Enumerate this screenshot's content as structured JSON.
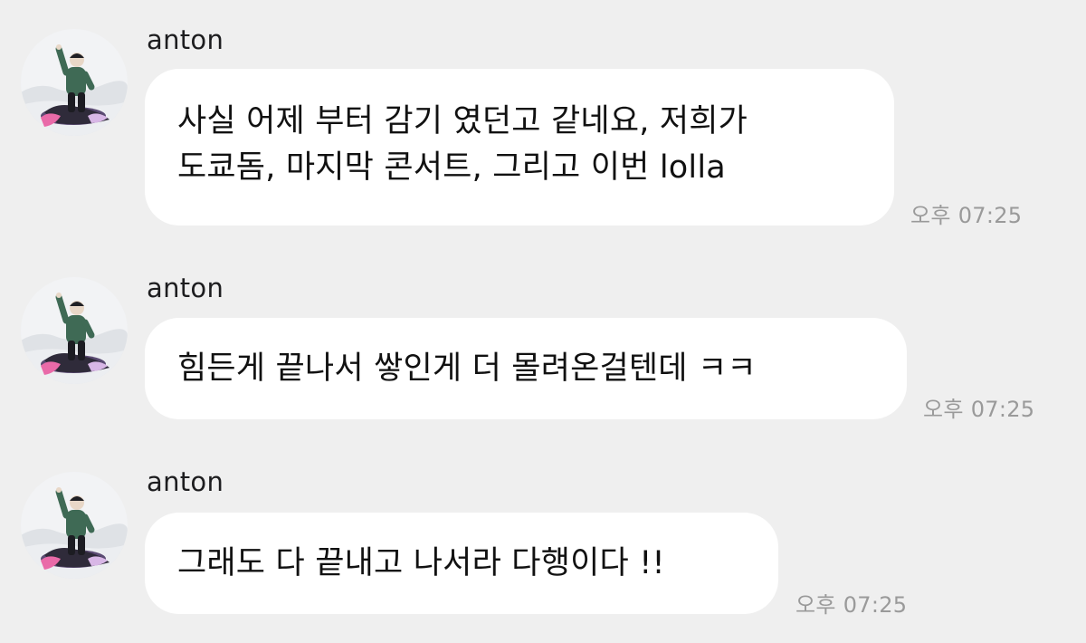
{
  "messages": [
    {
      "sender": "anton",
      "lines": [
        "사실 어제 부터 감기 였던고 같네요, 저희가",
        "도쿄돔, 마지막 콘서트, 그리고 이번 lolla"
      ],
      "time": "오후 07:25",
      "avatar_icon": "profile-photo-snowboarder"
    },
    {
      "sender": "anton",
      "lines": [
        "힘든게 끝나서 쌓인게 더 몰려온걸텐데 ㅋㅋ"
      ],
      "time": "오후 07:25",
      "avatar_icon": "profile-photo-snowboarder"
    },
    {
      "sender": "anton",
      "lines": [
        "그래도 다 끝내고 나서라 다행이다 !!"
      ],
      "time": "오후 07:25",
      "avatar_icon": "profile-photo-snowboarder"
    }
  ],
  "colors": {
    "background": "#efefef",
    "bubble": "#ffffff",
    "timestamp": "#9a9a9a"
  }
}
